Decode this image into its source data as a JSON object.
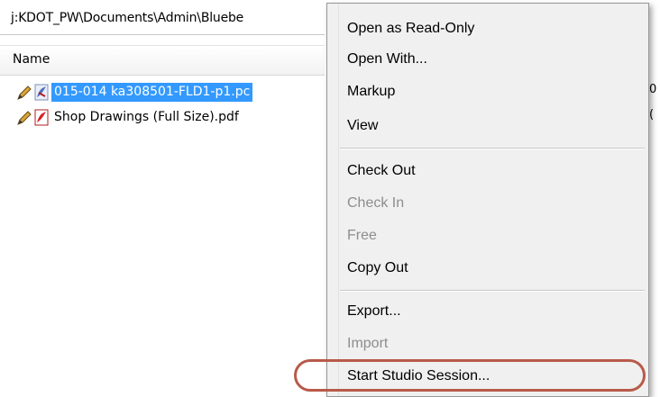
{
  "explorer": {
    "path": "j:KDOT_PW\\Documents\\Admin\\Bluebe",
    "column_name": "Name",
    "files": [
      {
        "name": "015-014 ka308501-FLD1-p1.pc",
        "selected": true,
        "icon": "pdf-red-blue-icon"
      },
      {
        "name": "Shop Drawings (Full Size).pdf",
        "selected": false,
        "icon": "pdf-red-icon"
      }
    ],
    "right_edge_chars": [
      "0",
      "("
    ]
  },
  "context_menu": {
    "groups": [
      [
        {
          "label": "Open as Read-Only",
          "enabled": true
        },
        {
          "label": "Open With...",
          "enabled": true
        },
        {
          "label": "Markup",
          "enabled": true
        },
        {
          "label": "View",
          "enabled": true
        }
      ],
      [
        {
          "label": "Check Out",
          "enabled": true
        },
        {
          "label": "Check In",
          "enabled": false
        },
        {
          "label": "Free",
          "enabled": false
        },
        {
          "label": "Copy Out",
          "enabled": true
        }
      ],
      [
        {
          "label": "Export...",
          "enabled": true
        },
        {
          "label": "Import",
          "enabled": false
        },
        {
          "label": "Start Studio Session...",
          "enabled": true,
          "highlighted": true
        }
      ]
    ]
  },
  "colors": {
    "selection": "#3399ff",
    "highlight_oval": "#b85a4a",
    "disabled_text": "#8d8d8d"
  }
}
